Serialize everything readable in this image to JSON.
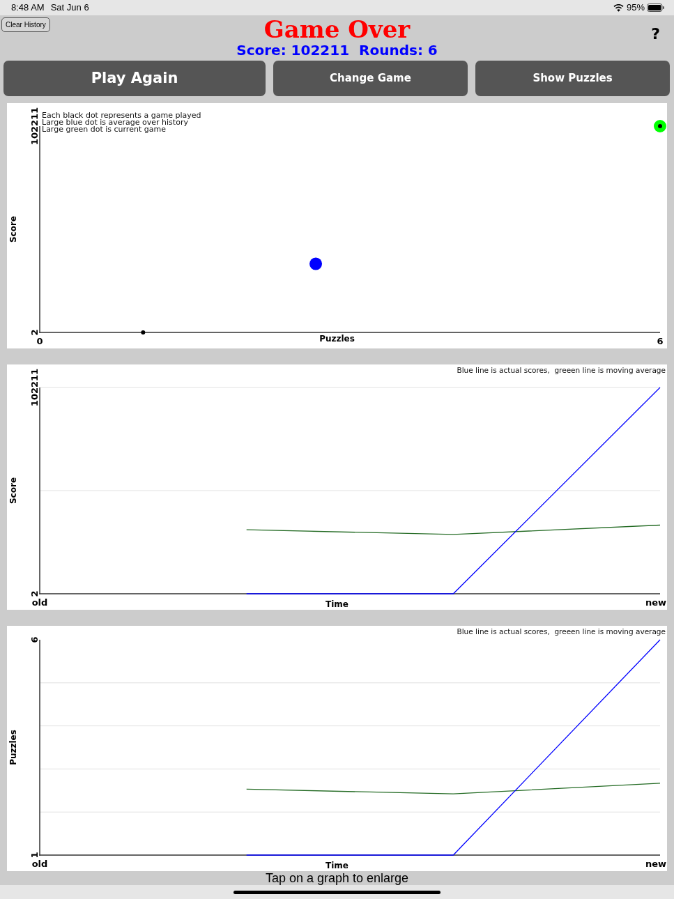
{
  "status_bar": {
    "time": "8:48 AM",
    "date": "Sat Jun 6",
    "battery": "95%"
  },
  "header": {
    "clear_button": "Clear History",
    "title": "Game Over",
    "score_line": "Score: 102211  Rounds: 6",
    "help_button": "?"
  },
  "buttons": [
    {
      "label": "Play Again",
      "kind": "primary"
    },
    {
      "label": "Change Game",
      "kind": "secondary"
    },
    {
      "label": "Show Puzzles",
      "kind": "secondary"
    }
  ],
  "graphs": [
    {
      "chart_data": {
        "type": "scatter",
        "xlabel": "Puzzles",
        "ylabel": "Score",
        "x": [
          1,
          2.67,
          6
        ],
        "series": [
          {
            "color": "#0000ff",
            "values": [
              null,
              34000,
              null
            ]
          },
          {
            "color": "#00ff00",
            "values": [
              null,
              null,
              102211
            ]
          },
          {
            "color": "#000000",
            "values": [
              2,
              null,
              102211
            ]
          }
        ],
        "xlim": [
          0,
          6
        ],
        "ylim": [
          2,
          102211
        ],
        "xticks": [
          0,
          6
        ],
        "yticks": [
          2,
          102211
        ],
        "annotations": [
          "Each black dot represents a game played",
          "Large blue dot is average over history",
          "Large green dot is current game"
        ]
      }
    },
    {
      "chart_data": {
        "type": "line",
        "xlabel": "Time",
        "ylabel": "Score",
        "categories": [
          "old",
          null,
          null,
          "new"
        ],
        "series": [
          {
            "color": "#246b24",
            "values": [
              null,
              31700,
              29400,
              34000
            ]
          },
          {
            "color": "#0000ff",
            "values": [
              null,
              2,
              2,
              102211
            ]
          }
        ],
        "ylim": [
          2,
          102211
        ],
        "yticks": [
          2,
          102211
        ],
        "ref_lines": [
          {
            "axis": "y",
            "value": 51106
          },
          {
            "axis": "y",
            "value": 102211
          }
        ],
        "annotations": [
          "Blue line is actual scores,  greeen line is moving average"
        ]
      }
    },
    {
      "chart_data": {
        "type": "line",
        "xlabel": "Time",
        "ylabel": "Puzzles",
        "categories": [
          "old",
          null,
          null,
          "new"
        ],
        "series": [
          {
            "color": "#246b24",
            "values": [
              null,
              2.53,
              2.42,
              2.67
            ]
          },
          {
            "color": "#0000ff",
            "values": [
              null,
              1,
              1,
              6
            ]
          }
        ],
        "ylim": [
          1,
          6
        ],
        "yticks": [
          1,
          6
        ],
        "ref_lines": [
          {
            "axis": "y",
            "value": 2
          },
          {
            "axis": "y",
            "value": 3
          },
          {
            "axis": "y",
            "value": 4
          },
          {
            "axis": "y",
            "value": 5
          }
        ],
        "annotations": [
          "Blue line is actual scores,  greeen line is moving average"
        ]
      }
    }
  ],
  "hint": "Tap on a graph to enlarge"
}
